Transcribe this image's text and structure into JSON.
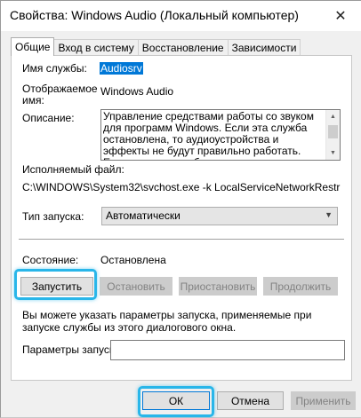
{
  "window": {
    "title": "Свойства: Windows Audio (Локальный компьютер)",
    "close_glyph": "✕"
  },
  "tabs": [
    {
      "label": "Общие",
      "active": true
    },
    {
      "label": "Вход в систему",
      "active": false
    },
    {
      "label": "Восстановление",
      "active": false
    },
    {
      "label": "Зависимости",
      "active": false
    }
  ],
  "general": {
    "service_name_label": "Имя службы:",
    "service_name_value": "Audiosrv",
    "display_name_label": "Отображаемое имя:",
    "display_name_value": "Windows Audio",
    "description_label": "Описание:",
    "description_text": "Управление средствами работы со звуком для программ Windows.  Если эта служба остановлена, то аудиоустройства и эффекты не будут правильно работать.  Если данная служба",
    "exec_label": "Исполняемый файл:",
    "exec_path": "C:\\WINDOWS\\System32\\svchost.exe -k LocalServiceNetworkRestricted -p",
    "startup_type_label": "Тип запуска:",
    "startup_type_value": "Автоматически",
    "status_label": "Состояние:",
    "status_value": "Остановлена",
    "start_button": "Запустить",
    "stop_button": "Остановить",
    "pause_button": "Приостановить",
    "resume_button": "Продолжить",
    "hint_text": "Вы можете указать параметры запуска, применяемые при запуске службы из этого диалогового окна.",
    "params_label": "Параметры запуска:",
    "params_value": ""
  },
  "footer": {
    "ok_button": "ОК",
    "cancel_button": "Отмена",
    "apply_button": "Применить"
  },
  "colors": {
    "highlight_ring": "#29b6e9",
    "selection": "#0078d7"
  }
}
